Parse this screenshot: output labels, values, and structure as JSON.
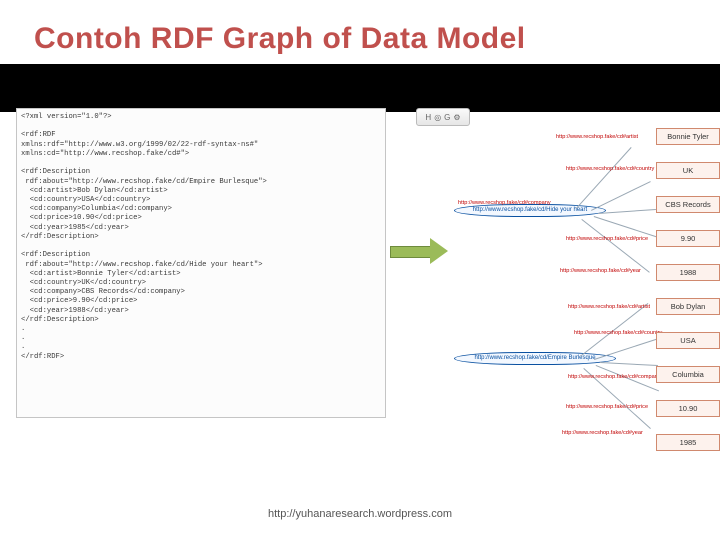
{
  "title": "Contoh RDF Graph of Data Model",
  "code": "<?xml version=\"1.0\"?>\n\n<rdf:RDF\nxmlns:rdf=\"http://www.w3.org/1999/02/22-rdf-syntax-ns#\"\nxmlns:cd=\"http://www.recshop.fake/cd#\">\n\n<rdf:Description\n rdf:about=\"http://www.recshop.fake/cd/Empire Burlesque\">\n  <cd:artist>Bob Dylan</cd:artist>\n  <cd:country>USA</cd:country>\n  <cd:company>Columbia</cd:company>\n  <cd:price>10.90</cd:price>\n  <cd:year>1985</cd:year>\n</rdf:Description>\n\n<rdf:Description\n rdf:about=\"http://www.recshop.fake/cd/Hide your heart\">\n  <cd:artist>Bonnie Tyler</cd:artist>\n  <cd:country>UK</cd:country>\n  <cd:company>CBS Records</cd:company>\n  <cd:price>9.90</cd:price>\n  <cd:year>1988</cd:year>\n</rdf:Description>\n.\n.\n.\n</rdf:RDF>",
  "toolbar": {
    "a": "H",
    "b": "◎",
    "c": "G",
    "d": "⚙"
  },
  "nodes": {
    "hide": "http://www.recshop.fake/cd/Hide your heart",
    "empire": "http://www.recshop.fake/cd/Empire Burlesque"
  },
  "links": {
    "artist": "http://www.recshop.fake/cd#artist",
    "country": "http://www.recshop.fake/cd#country",
    "company": "http://www.recshop.fake/cd#company",
    "price": "http://www.recshop.fake/cd#price",
    "year": "http://www.recshop.fake/cd#year"
  },
  "leaves": {
    "bonnie": "Bonnie Tyler",
    "uk": "UK",
    "cbs": "CBS Records",
    "p990": "9.90",
    "y1988": "1988",
    "dylan": "Bob Dylan",
    "usa": "USA",
    "columbia": "Columbia",
    "p1090": "10.90",
    "y1985": "1985"
  },
  "footer": "http://yuhanaresearch.wordpress.com"
}
